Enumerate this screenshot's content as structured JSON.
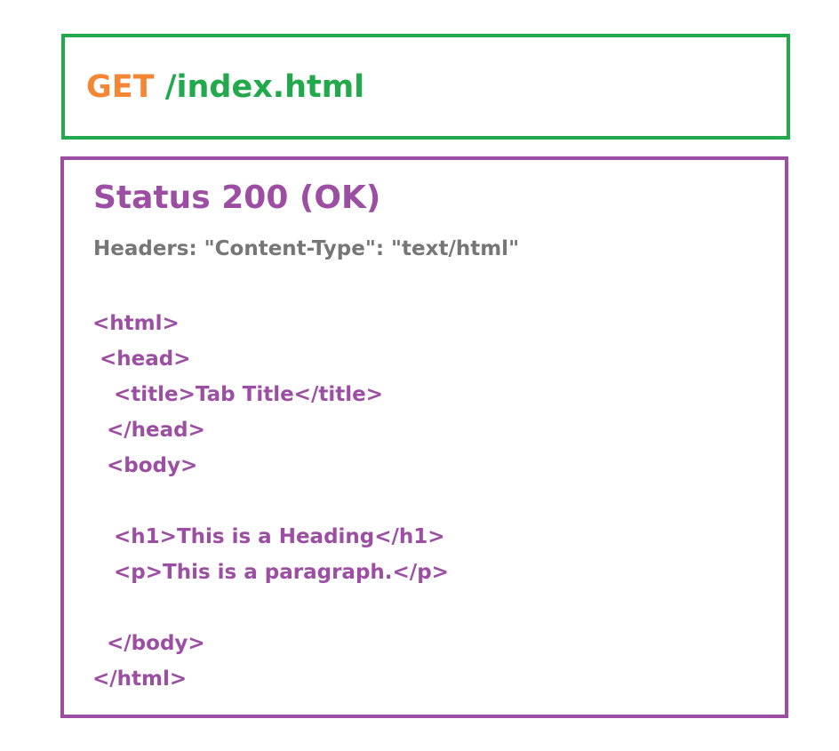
{
  "request": {
    "method": "GET",
    "path": "/index.html"
  },
  "response": {
    "status": "Status 200 (OK)",
    "headers": "Headers: \"Content-Type\": \"text/html\"",
    "body_lines": [
      "<html>",
      " <head>",
      "   <title>Tab Title</title>",
      "  </head>",
      "  <body>",
      "",
      "   <h1>This is a Heading</h1>",
      "   <p>This is a paragraph.</p>",
      "",
      "  </body>",
      "</html>"
    ]
  },
  "colors": {
    "method": "#f58634",
    "path": "#22a94b",
    "request_border": "#22a94b",
    "response_border": "#9c4fa2",
    "response_text": "#9c4fa2",
    "headers_text": "#767676"
  }
}
